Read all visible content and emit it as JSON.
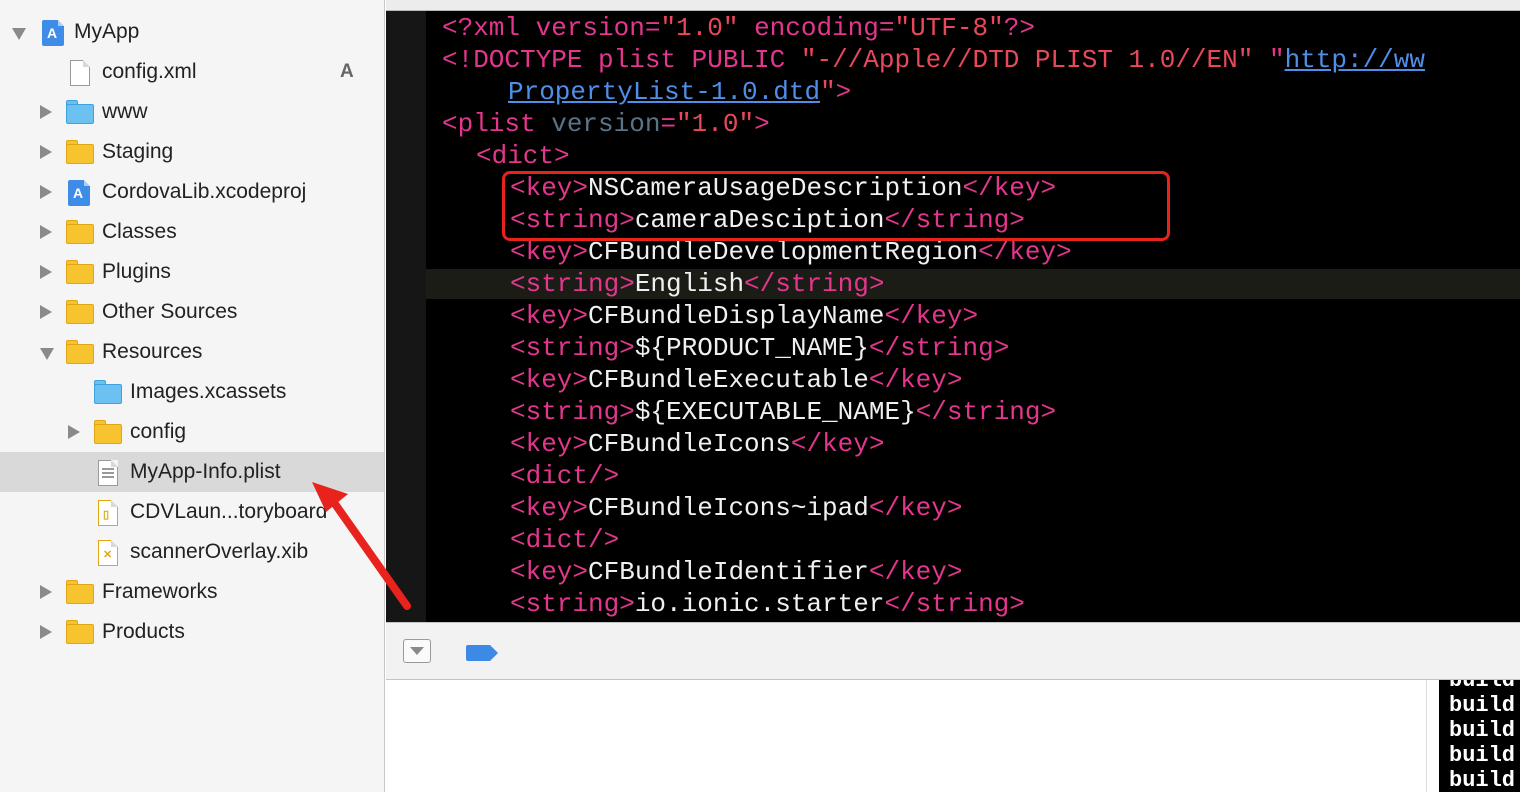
{
  "navigator": {
    "items": [
      {
        "label": "MyApp",
        "badge": "",
        "icon": "xcode-project-icon",
        "disclosure": "open",
        "selected": false
      },
      {
        "label": "config.xml",
        "badge": "A",
        "icon": "file-icon",
        "disclosure": "none",
        "selected": false
      },
      {
        "label": "www",
        "badge": "",
        "icon": "blue-folder-icon",
        "disclosure": "closed",
        "selected": false
      },
      {
        "label": "Staging",
        "badge": "",
        "icon": "folder-icon",
        "disclosure": "closed",
        "selected": false
      },
      {
        "label": "CordovaLib.xcodeproj",
        "badge": "",
        "icon": "xcode-project-icon",
        "disclosure": "closed",
        "selected": false
      },
      {
        "label": "Classes",
        "badge": "",
        "icon": "folder-icon",
        "disclosure": "closed",
        "selected": false
      },
      {
        "label": "Plugins",
        "badge": "",
        "icon": "folder-icon",
        "disclosure": "closed",
        "selected": false
      },
      {
        "label": "Other Sources",
        "badge": "",
        "icon": "folder-icon",
        "disclosure": "closed",
        "selected": false
      },
      {
        "label": "Resources",
        "badge": "",
        "icon": "folder-icon",
        "disclosure": "open",
        "selected": false
      },
      {
        "label": "Images.xcassets",
        "badge": "",
        "icon": "asset-catalog-icon",
        "disclosure": "none",
        "selected": false
      },
      {
        "label": "config",
        "badge": "",
        "icon": "folder-icon",
        "disclosure": "closed",
        "selected": false
      },
      {
        "label": "MyApp-Info.plist",
        "badge": "",
        "icon": "plist-file-icon",
        "disclosure": "none",
        "selected": true
      },
      {
        "label": "CDVLaun...toryboard",
        "badge": "",
        "icon": "storyboard-file-icon",
        "disclosure": "none",
        "selected": false
      },
      {
        "label": "scannerOverlay.xib",
        "badge": "",
        "icon": "xib-file-icon",
        "disclosure": "none",
        "selected": false
      },
      {
        "label": "Frameworks",
        "badge": "",
        "icon": "folder-icon",
        "disclosure": "closed",
        "selected": false
      },
      {
        "label": "Products",
        "badge": "",
        "icon": "folder-icon",
        "disclosure": "closed",
        "selected": false
      }
    ]
  },
  "editor": {
    "lines": [
      [
        {
          "t": "tag",
          "v": "<?xml "
        },
        {
          "t": "tag",
          "v": "version="
        },
        {
          "t": "str",
          "v": "\"1.0\""
        },
        {
          "t": "tag",
          "v": " encoding="
        },
        {
          "t": "str",
          "v": "\"UTF-8\""
        },
        {
          "t": "tag",
          "v": "?>"
        }
      ],
      [
        {
          "t": "tag",
          "v": "<!DOCTYPE plist PUBLIC "
        },
        {
          "t": "str",
          "v": "\"-//Apple//DTD PLIST 1.0//EN\""
        },
        {
          "t": "tag",
          "v": " \""
        },
        {
          "t": "url",
          "v": "http://ww"
        }
      ],
      [
        {
          "t": "url",
          "v": "PropertyList-1.0.dtd"
        },
        {
          "t": "str",
          "v": "\""
        },
        {
          "t": "tag",
          "v": ">"
        }
      ],
      [
        {
          "t": "tag",
          "v": "<plist "
        },
        {
          "t": "attr",
          "v": "version"
        },
        {
          "t": "tag",
          "v": "="
        },
        {
          "t": "str",
          "v": "\"1.0\""
        },
        {
          "t": "tag",
          "v": ">"
        }
      ],
      [
        {
          "t": "tag",
          "v": "<dict>"
        }
      ],
      [
        {
          "t": "tag",
          "v": "<key>"
        },
        {
          "t": "txt",
          "v": "NSCameraUsageDescription"
        },
        {
          "t": "tag",
          "v": "</key>"
        }
      ],
      [
        {
          "t": "tag",
          "v": "<string>"
        },
        {
          "t": "txt",
          "v": "cameraDesciption"
        },
        {
          "t": "tag",
          "v": "</string>"
        }
      ],
      [
        {
          "t": "tag",
          "v": "<key>"
        },
        {
          "t": "txt",
          "v": "CFBundleDevelopmentRegion"
        },
        {
          "t": "tag",
          "v": "</key>"
        }
      ],
      [
        {
          "t": "tag",
          "v": "<string>"
        },
        {
          "t": "txt",
          "v": "English"
        },
        {
          "t": "tag",
          "v": "</string>"
        }
      ],
      [
        {
          "t": "tag",
          "v": "<key>"
        },
        {
          "t": "txt",
          "v": "CFBundleDisplayName"
        },
        {
          "t": "tag",
          "v": "</key>"
        }
      ],
      [
        {
          "t": "tag",
          "v": "<string>"
        },
        {
          "t": "txt",
          "v": "${PRODUCT_NAME}"
        },
        {
          "t": "tag",
          "v": "</string>"
        }
      ],
      [
        {
          "t": "tag",
          "v": "<key>"
        },
        {
          "t": "txt",
          "v": "CFBundleExecutable"
        },
        {
          "t": "tag",
          "v": "</key>"
        }
      ],
      [
        {
          "t": "tag",
          "v": "<string>"
        },
        {
          "t": "txt",
          "v": "${EXECUTABLE_NAME}"
        },
        {
          "t": "tag",
          "v": "</string>"
        }
      ],
      [
        {
          "t": "tag",
          "v": "<key>"
        },
        {
          "t": "txt",
          "v": "CFBundleIcons"
        },
        {
          "t": "tag",
          "v": "</key>"
        }
      ],
      [
        {
          "t": "tag",
          "v": "<dict/>"
        }
      ],
      [
        {
          "t": "tag",
          "v": "<key>"
        },
        {
          "t": "txt",
          "v": "CFBundleIcons~ipad"
        },
        {
          "t": "tag",
          "v": "</key>"
        }
      ],
      [
        {
          "t": "tag",
          "v": "<dict/>"
        }
      ],
      [
        {
          "t": "tag",
          "v": "<key>"
        },
        {
          "t": "txt",
          "v": "CFBundleIdentifier"
        },
        {
          "t": "tag",
          "v": "</key>"
        }
      ],
      [
        {
          "t": "tag",
          "v": "<string>"
        },
        {
          "t": "txt",
          "v": "io.ionic.starter"
        },
        {
          "t": "tag",
          "v": "</string>"
        }
      ]
    ]
  },
  "console": {
    "terminal_lines": [
      "build",
      "build",
      "build",
      "build",
      "build"
    ]
  },
  "colors": {
    "tag": "#e3368d",
    "string_literal": "#e8495a",
    "text": "#f0f0f0",
    "url": "#4f8fe8",
    "annotation": "#e8221c",
    "selection": "#d9d9d9"
  }
}
